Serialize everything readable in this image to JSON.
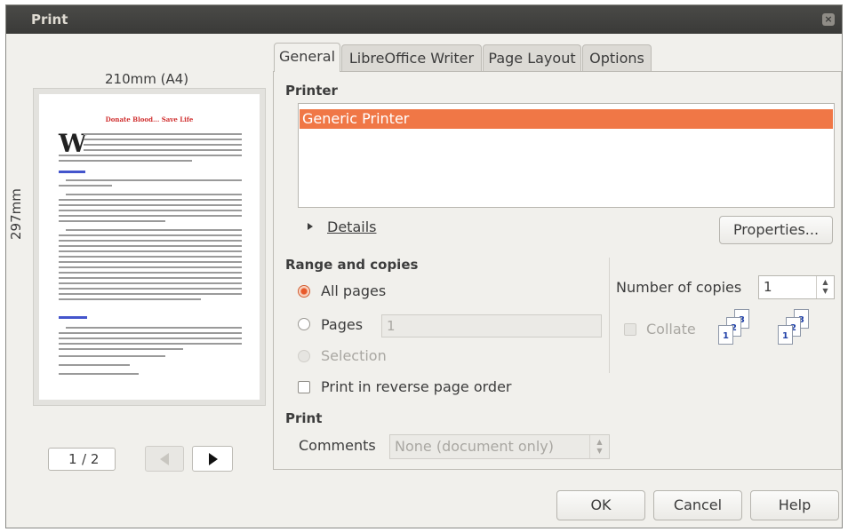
{
  "window": {
    "title": "Print"
  },
  "preview": {
    "width_label": "210mm (A4)",
    "height_label": "297mm",
    "doc_heading": "Donate Blood... Save Life",
    "current_page": "1",
    "total_pages": "/ 2"
  },
  "tabs": [
    "General",
    "LibreOffice Writer",
    "Page Layout",
    "Options"
  ],
  "printer": {
    "heading": "Printer",
    "items": [
      "Generic Printer"
    ],
    "details_label": "Details",
    "properties_label": "Properties..."
  },
  "range": {
    "heading": "Range and copies",
    "all_pages": "All pages",
    "pages": "Pages",
    "pages_value": "1",
    "selection": "Selection",
    "reverse": "Print in reverse page order",
    "number_of_copies_label": "Number of copies",
    "copies_value": "1",
    "collate": "Collate"
  },
  "print_section": {
    "heading": "Print",
    "comments_label": "Comments",
    "comments_value": "None (document only)"
  },
  "buttons": {
    "ok": "OK",
    "cancel": "Cancel",
    "help": "Help"
  },
  "colors": {
    "selection": "#f07746",
    "accent": "#e8592a",
    "titlebar": "#3a3a38"
  }
}
